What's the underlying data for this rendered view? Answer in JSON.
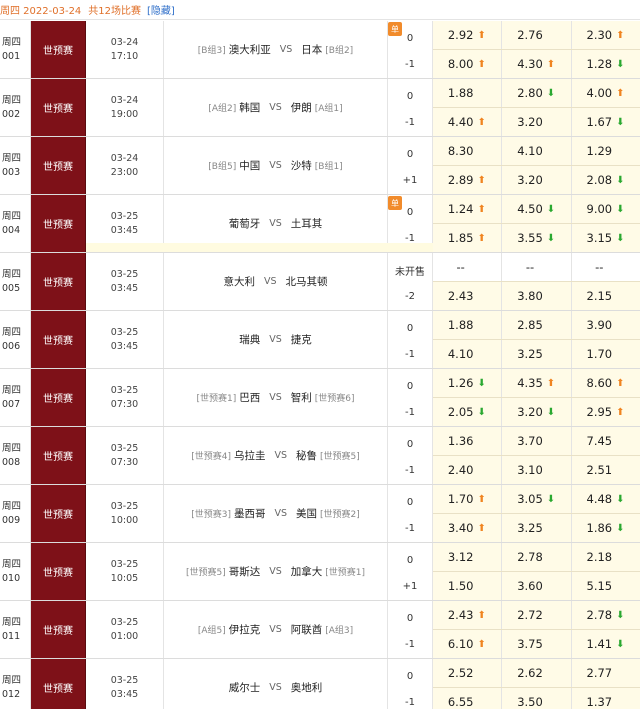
{
  "header": {
    "date": "周四 2022-03-24",
    "count": "共12场比赛",
    "hide": "[隐藏]"
  },
  "icons": {
    "up": "arrow-up-icon",
    "down": "arrow-down-icon"
  },
  "colors": {
    "league_bg": "#7e1118",
    "up": "#f08420",
    "down": "#2aa830",
    "dan": "#f18b2b"
  },
  "matches": [
    {
      "num": [
        "周四",
        "001"
      ],
      "league": "世预赛",
      "date": "03-24",
      "time": "17:10",
      "home_tag": "[B组3]",
      "home": "澳大利亚",
      "vs": "VS",
      "away": "日本",
      "away_tag": "[B组2]",
      "dan": "单",
      "hc": [
        "0",
        "-1"
      ],
      "odds": [
        [
          [
            "2.92",
            "up"
          ],
          [
            "2.76",
            ""
          ],
          [
            "2.30",
            "up"
          ]
        ],
        [
          [
            "8.00",
            "up"
          ],
          [
            "4.30",
            "up"
          ],
          [
            "1.28",
            "down"
          ]
        ]
      ]
    },
    {
      "num": [
        "周四",
        "002"
      ],
      "league": "世预赛",
      "date": "03-24",
      "time": "19:00",
      "home_tag": "[A组2]",
      "home": "韩国",
      "vs": "VS",
      "away": "伊朗",
      "away_tag": "[A组1]",
      "dan": "",
      "hc": [
        "0",
        "-1"
      ],
      "odds": [
        [
          [
            "1.88",
            ""
          ],
          [
            "2.80",
            "down"
          ],
          [
            "4.00",
            "up"
          ]
        ],
        [
          [
            "4.40",
            "up"
          ],
          [
            "3.20",
            ""
          ],
          [
            "1.67",
            "down"
          ]
        ]
      ]
    },
    {
      "num": [
        "周四",
        "003"
      ],
      "league": "世预赛",
      "date": "03-24",
      "time": "23:00",
      "home_tag": "[B组5]",
      "home": "中国",
      "vs": "VS",
      "away": "沙特",
      "away_tag": "[B组1]",
      "dan": "",
      "hc": [
        "0",
        "+1"
      ],
      "odds": [
        [
          [
            "8.30",
            ""
          ],
          [
            "4.10",
            ""
          ],
          [
            "1.29",
            ""
          ]
        ],
        [
          [
            "2.89",
            "up"
          ],
          [
            "3.20",
            ""
          ],
          [
            "2.08",
            "down"
          ]
        ]
      ]
    },
    {
      "num": [
        "周四",
        "004"
      ],
      "league": "世预赛",
      "date": "03-25",
      "time": "03:45",
      "home_tag": "",
      "home": "葡萄牙",
      "vs": "VS",
      "away": "土耳其",
      "away_tag": "",
      "dan": "单",
      "hc": [
        "0",
        "-1"
      ],
      "odds": [
        [
          [
            "1.24",
            "up"
          ],
          [
            "4.50",
            "down"
          ],
          [
            "9.00",
            "down"
          ]
        ],
        [
          [
            "1.85",
            "up"
          ],
          [
            "3.55",
            "down"
          ],
          [
            "3.15",
            "down"
          ]
        ]
      ]
    },
    {
      "num": [
        "周四",
        "005"
      ],
      "league": "世预赛",
      "date": "03-25",
      "time": "03:45",
      "home_tag": "",
      "home": "意大利",
      "vs": "VS",
      "away": "北马其顿",
      "away_tag": "",
      "dan": "",
      "hc": [
        "未开售",
        "-2"
      ],
      "odds": [
        [
          [
            "--",
            ""
          ],
          [
            "--",
            ""
          ],
          [
            "--",
            ""
          ]
        ],
        [
          [
            "2.43",
            ""
          ],
          [
            "3.80",
            ""
          ],
          [
            "2.15",
            ""
          ]
        ]
      ]
    },
    {
      "num": [
        "周四",
        "006"
      ],
      "league": "世预赛",
      "date": "03-25",
      "time": "03:45",
      "home_tag": "",
      "home": "瑞典",
      "vs": "VS",
      "away": "捷克",
      "away_tag": "",
      "dan": "",
      "hc": [
        "0",
        "-1"
      ],
      "odds": [
        [
          [
            "1.88",
            ""
          ],
          [
            "2.85",
            ""
          ],
          [
            "3.90",
            ""
          ]
        ],
        [
          [
            "4.10",
            ""
          ],
          [
            "3.25",
            ""
          ],
          [
            "1.70",
            ""
          ]
        ]
      ]
    },
    {
      "num": [
        "周四",
        "007"
      ],
      "league": "世预赛",
      "date": "03-25",
      "time": "07:30",
      "home_tag": "[世预赛1]",
      "home": "巴西",
      "vs": "VS",
      "away": "智利",
      "away_tag": "[世预赛6]",
      "dan": "",
      "hc": [
        "0",
        "-1"
      ],
      "odds": [
        [
          [
            "1.26",
            "down"
          ],
          [
            "4.35",
            "up"
          ],
          [
            "8.60",
            "up"
          ]
        ],
        [
          [
            "2.05",
            "down"
          ],
          [
            "3.20",
            "down"
          ],
          [
            "2.95",
            "up"
          ]
        ]
      ]
    },
    {
      "num": [
        "周四",
        "008"
      ],
      "league": "世预赛",
      "date": "03-25",
      "time": "07:30",
      "home_tag": "[世预赛4]",
      "home": "乌拉圭",
      "vs": "VS",
      "away": "秘鲁",
      "away_tag": "[世预赛5]",
      "dan": "",
      "hc": [
        "0",
        "-1"
      ],
      "odds": [
        [
          [
            "1.36",
            ""
          ],
          [
            "3.70",
            ""
          ],
          [
            "7.45",
            ""
          ]
        ],
        [
          [
            "2.40",
            ""
          ],
          [
            "3.10",
            ""
          ],
          [
            "2.51",
            ""
          ]
        ]
      ]
    },
    {
      "num": [
        "周四",
        "009"
      ],
      "league": "世预赛",
      "date": "03-25",
      "time": "10:00",
      "home_tag": "[世预赛3]",
      "home": "墨西哥",
      "vs": "VS",
      "away": "美国",
      "away_tag": "[世预赛2]",
      "dan": "",
      "hc": [
        "0",
        "-1"
      ],
      "odds": [
        [
          [
            "1.70",
            "up"
          ],
          [
            "3.05",
            "down"
          ],
          [
            "4.48",
            "down"
          ]
        ],
        [
          [
            "3.40",
            "up"
          ],
          [
            "3.25",
            ""
          ],
          [
            "1.86",
            "down"
          ]
        ]
      ]
    },
    {
      "num": [
        "周四",
        "010"
      ],
      "league": "世预赛",
      "date": "03-25",
      "time": "10:05",
      "home_tag": "[世预赛5]",
      "home": "哥斯达",
      "vs": "VS",
      "away": "加拿大",
      "away_tag": "[世预赛1]",
      "dan": "",
      "hc": [
        "0",
        "+1"
      ],
      "odds": [
        [
          [
            "3.12",
            ""
          ],
          [
            "2.78",
            ""
          ],
          [
            "2.18",
            ""
          ]
        ],
        [
          [
            "1.50",
            ""
          ],
          [
            "3.60",
            ""
          ],
          [
            "5.15",
            ""
          ]
        ]
      ]
    },
    {
      "num": [
        "周四",
        "011"
      ],
      "league": "世预赛",
      "date": "03-25",
      "time": "01:00",
      "home_tag": "[A组5]",
      "home": "伊拉克",
      "vs": "VS",
      "away": "阿联酋",
      "away_tag": "[A组3]",
      "dan": "",
      "hc": [
        "0",
        "-1"
      ],
      "odds": [
        [
          [
            "2.43",
            "up"
          ],
          [
            "2.72",
            ""
          ],
          [
            "2.78",
            "down"
          ]
        ],
        [
          [
            "6.10",
            "up"
          ],
          [
            "3.75",
            ""
          ],
          [
            "1.41",
            "down"
          ]
        ]
      ]
    },
    {
      "num": [
        "周四",
        "012"
      ],
      "league": "世预赛",
      "date": "03-25",
      "time": "03:45",
      "home_tag": "",
      "home": "威尔士",
      "vs": "VS",
      "away": "奥地利",
      "away_tag": "",
      "dan": "",
      "hc": [
        "0",
        "-1"
      ],
      "odds": [
        [
          [
            "2.52",
            ""
          ],
          [
            "2.62",
            ""
          ],
          [
            "2.77",
            ""
          ]
        ],
        [
          [
            "6.55",
            ""
          ],
          [
            "3.50",
            ""
          ],
          [
            "1.37",
            ""
          ]
        ]
      ]
    }
  ]
}
